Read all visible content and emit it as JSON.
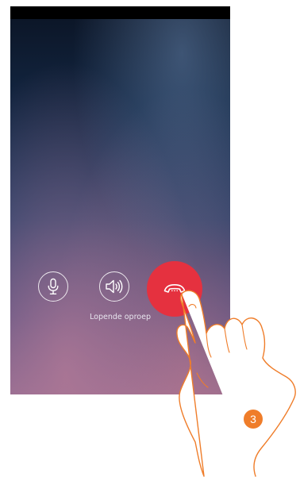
{
  "call": {
    "status_text": "Lopende oproep",
    "buttons": {
      "mute_icon": "microphone-icon",
      "speaker_icon": "speaker-volume-icon",
      "end_icon": "hang-up-phone-icon"
    }
  },
  "annotation": {
    "step_number": "3",
    "badge_color": "#ef7d2a"
  },
  "colors": {
    "end_call": "#e5313f"
  }
}
